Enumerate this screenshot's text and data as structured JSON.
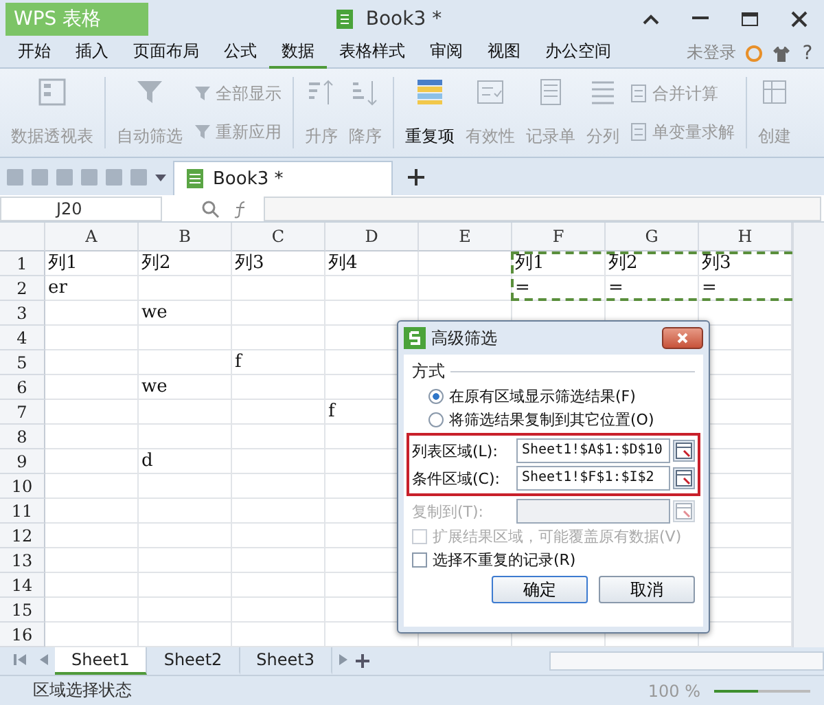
{
  "app": {
    "brand": "WPS 表格",
    "title": "Book3 *"
  },
  "menu": [
    {
      "label": "开始",
      "selected": false
    },
    {
      "label": "插入",
      "selected": false
    },
    {
      "label": "页面布局",
      "selected": false
    },
    {
      "label": "公式",
      "selected": false
    },
    {
      "label": "数据",
      "selected": true
    },
    {
      "label": "表格样式",
      "selected": false
    },
    {
      "label": "审阅",
      "selected": false
    },
    {
      "label": "视图",
      "selected": false
    },
    {
      "label": "办公空间",
      "selected": false
    }
  ],
  "login": "未登录",
  "help": "?",
  "ribbon": [
    {
      "kind": "large",
      "label": "数据透视表",
      "disabled": true
    },
    {
      "kind": "sep"
    },
    {
      "kind": "large",
      "label": "自动筛选",
      "disabled": true
    },
    {
      "kind": "stack",
      "items": [
        {
          "label": "全部显示",
          "disabled": true
        },
        {
          "label": "重新应用",
          "disabled": true
        }
      ]
    },
    {
      "kind": "sep"
    },
    {
      "kind": "large",
      "label": "升序",
      "disabled": true
    },
    {
      "kind": "large",
      "label": "降序",
      "disabled": true
    },
    {
      "kind": "sep"
    },
    {
      "kind": "large",
      "label": "重复项",
      "disabled": false
    },
    {
      "kind": "large",
      "label": "有效性",
      "disabled": true
    },
    {
      "kind": "large",
      "label": "记录单",
      "disabled": true
    },
    {
      "kind": "large",
      "label": "分列",
      "disabled": true
    },
    {
      "kind": "stack",
      "items": [
        {
          "label": "合并计算",
          "disabled": true
        },
        {
          "label": "单变量求解",
          "disabled": true
        }
      ]
    },
    {
      "kind": "sep"
    },
    {
      "kind": "large",
      "label": "创建",
      "disabled": true
    }
  ],
  "doc_tab": "Book3 *",
  "name_box": "J20",
  "columns": [
    "A",
    "B",
    "C",
    "D",
    "E",
    "F",
    "G",
    "H"
  ],
  "rows": [
    {
      "header": "1",
      "cells": {
        "A": "列1",
        "B": "列2",
        "C": "列3",
        "D": "列4",
        "F": "列1",
        "G": "列2",
        "H": "列3"
      }
    },
    {
      "header": "2",
      "cells": {
        "A": "er",
        "F": "=",
        "G": "=",
        "H": "="
      }
    },
    {
      "header": "3",
      "cells": {
        "B": "we"
      }
    },
    {
      "header": "4",
      "cells": {}
    },
    {
      "header": "5",
      "cells": {
        "C": "f"
      }
    },
    {
      "header": "6",
      "cells": {
        "B": "we"
      }
    },
    {
      "header": "7",
      "cells": {
        "D": "f"
      }
    },
    {
      "header": "8",
      "cells": {}
    },
    {
      "header": "9",
      "cells": {
        "B": "d"
      }
    },
    {
      "header": "10",
      "cells": {}
    },
    {
      "header": "11",
      "cells": {}
    },
    {
      "header": "12",
      "cells": {}
    },
    {
      "header": "13",
      "cells": {}
    },
    {
      "header": "14",
      "cells": {}
    },
    {
      "header": "15",
      "cells": {}
    },
    {
      "header": "16",
      "cells": {}
    }
  ],
  "sheets": [
    {
      "label": "Sheet1",
      "selected": true
    },
    {
      "label": "Sheet2",
      "selected": false
    },
    {
      "label": "Sheet3",
      "selected": false
    }
  ],
  "status": {
    "text": "区域选择状态",
    "zoom": "100 %",
    "zoom_slider": {
      "level": 0.45
    }
  },
  "dialog": {
    "title": "高级筛选",
    "section": "方式",
    "radios": [
      {
        "label": "在原有区域显示筛选结果(F)",
        "selected": true
      },
      {
        "label": "将筛选结果复制到其它位置(O)",
        "selected": false
      }
    ],
    "fields": [
      {
        "label": "列表区域(L):",
        "value": "Sheet1!$A$1:$D$10",
        "disabled": false,
        "highlighted": true
      },
      {
        "label": "条件区域(C):",
        "value": "Sheet1!$F$1:$I$2",
        "disabled": false,
        "highlighted": true
      },
      {
        "label": "复制到(T):",
        "disabled": true,
        "highlighted": false
      }
    ],
    "checkboxes": [
      {
        "label": "扩展结果区域，可能覆盖原有数据(V)",
        "checked": false,
        "disabled": true
      },
      {
        "label": "选择不重复的记录(R)",
        "checked": false,
        "disabled": false
      }
    ],
    "buttons": [
      {
        "label": "确定",
        "default": true
      },
      {
        "label": "取消",
        "default": false
      }
    ]
  }
}
